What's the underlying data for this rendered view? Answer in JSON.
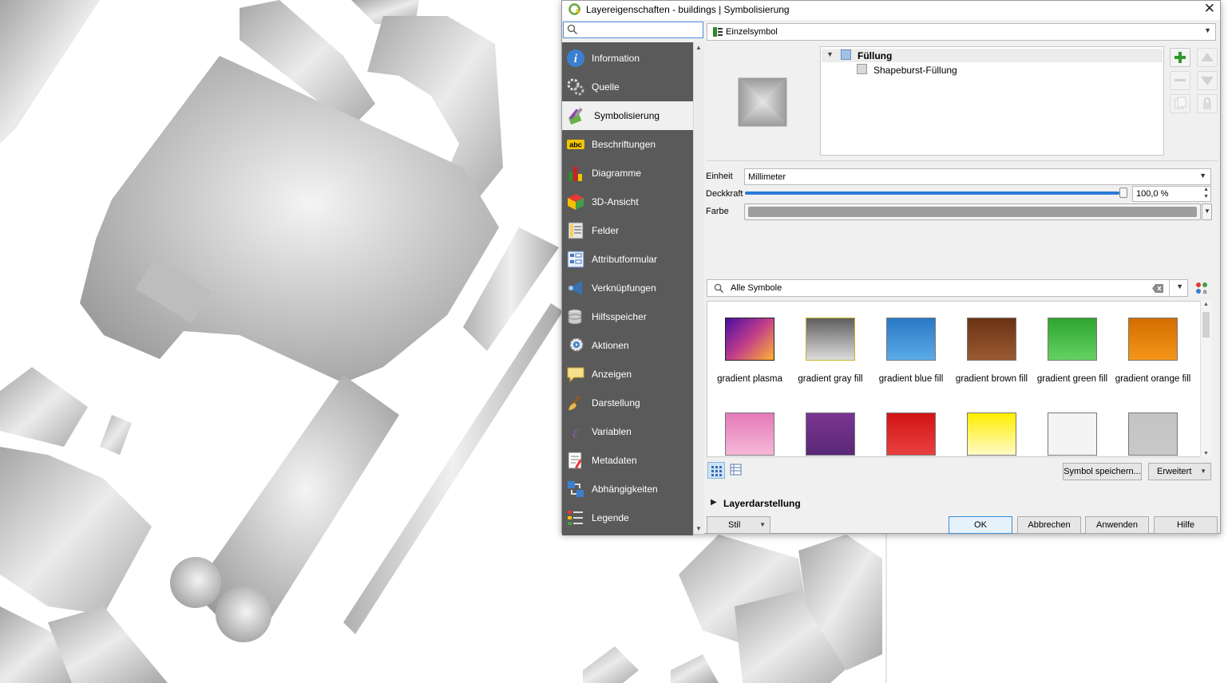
{
  "dialog": {
    "title": "Layereigenschaften - buildings | Symbolisierung",
    "search_placeholder": ""
  },
  "nav": {
    "items": [
      {
        "label": "Information",
        "icon": "information-icon"
      },
      {
        "label": "Quelle",
        "icon": "source-icon"
      },
      {
        "label": "Symbolisierung",
        "icon": "symbology-icon"
      },
      {
        "label": "Beschriftungen",
        "icon": "labels-icon"
      },
      {
        "label": "Diagramme",
        "icon": "diagrams-icon"
      },
      {
        "label": "3D-Ansicht",
        "icon": "3d-view-icon"
      },
      {
        "label": "Felder",
        "icon": "fields-icon"
      },
      {
        "label": "Attributformular",
        "icon": "attribute-form-icon"
      },
      {
        "label": "Verknüpfungen",
        "icon": "joins-icon"
      },
      {
        "label": "Hilfsspeicher",
        "icon": "auxiliary-storage-icon"
      },
      {
        "label": "Aktionen",
        "icon": "actions-icon"
      },
      {
        "label": "Anzeigen",
        "icon": "display-icon"
      },
      {
        "label": "Darstellung",
        "icon": "rendering-icon"
      },
      {
        "label": "Variablen",
        "icon": "variables-icon"
      },
      {
        "label": "Metadaten",
        "icon": "metadata-icon"
      },
      {
        "label": "Abhängigkeiten",
        "icon": "dependencies-icon"
      },
      {
        "label": "Legende",
        "icon": "legend-icon"
      }
    ],
    "active_index": 2
  },
  "renderer": {
    "type_label": "Einzelsymbol"
  },
  "symbol_tree": {
    "root": "Füllung",
    "child": "Shapeburst-Füllung"
  },
  "properties": {
    "unit_label": "Einheit",
    "unit_value": "Millimeter",
    "opacity_label": "Deckkraft",
    "opacity_value": "100,0 %",
    "opacity_fraction": 1.0,
    "color_label": "Farbe",
    "color_value": "#9e9e9e"
  },
  "library": {
    "search_value": "Alle Symbole",
    "symbols": [
      {
        "name": "gradient plasma",
        "colors": [
          "#4a0ea0",
          "#c13e8a",
          "#ffb232"
        ]
      },
      {
        "name": "gradient  gray fill",
        "colors": [
          "#5f5f5f",
          "#dcdcdc"
        ]
      },
      {
        "name": "gradient blue fill",
        "colors": [
          "#2a78c6",
          "#5aabe6"
        ]
      },
      {
        "name": "gradient brown fill",
        "colors": [
          "#6a3214",
          "#9b5a32"
        ]
      },
      {
        "name": "gradient green fill",
        "colors": [
          "#2ea52e",
          "#64d264"
        ]
      },
      {
        "name": "gradient orange fill",
        "colors": [
          "#d26e00",
          "#f59619"
        ]
      },
      {
        "name": "",
        "colors": [
          "#e47ab8",
          "#f6b7d8"
        ]
      },
      {
        "name": "",
        "colors": [
          "#7a3590",
          "#5a2878"
        ]
      },
      {
        "name": "",
        "colors": [
          "#d21414",
          "#e84040"
        ]
      },
      {
        "name": "",
        "colors": [
          "#ffee00",
          "#fffbc8"
        ]
      },
      {
        "name": "",
        "colors": [
          "#f4f4f4",
          "#f4f4f4"
        ]
      },
      {
        "name": "",
        "colors": [
          "#c4c4c4",
          "#c8c8c8"
        ]
      }
    ],
    "save_button": "Symbol speichern...",
    "advanced_button": "Erweitert"
  },
  "layer_rendering": {
    "label": "Layerdarstellung"
  },
  "footer": {
    "style_button": "Stil",
    "ok": "OK",
    "cancel": "Abbrechen",
    "apply": "Anwenden",
    "help": "Hilfe"
  }
}
